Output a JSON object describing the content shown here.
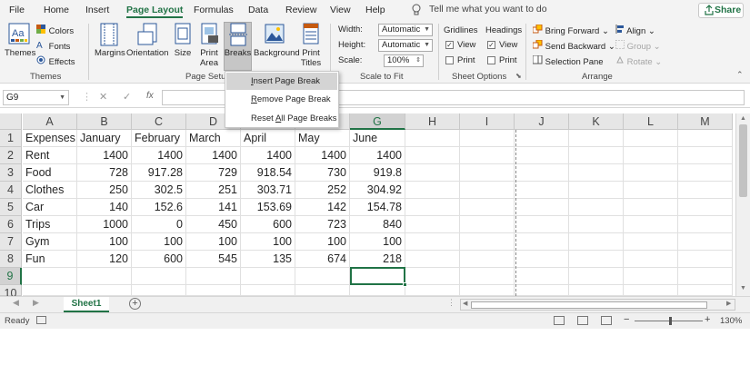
{
  "menu": {
    "tabs": [
      {
        "label": "File"
      },
      {
        "label": "Home"
      },
      {
        "label": "Insert"
      },
      {
        "label": "Page Layout",
        "active": true
      },
      {
        "label": "Formulas"
      },
      {
        "label": "Data"
      },
      {
        "label": "Review"
      },
      {
        "label": "View"
      },
      {
        "label": "Help"
      }
    ],
    "tell_me": "Tell me what you want to do",
    "share": "Share"
  },
  "ribbon": {
    "themes": {
      "big": "Themes",
      "colors": "Colors",
      "fonts": "Fonts",
      "effects": "Effects",
      "group": "Themes"
    },
    "page_setup": {
      "margins": "Margins",
      "orientation": "Orientation",
      "size": "Size",
      "print_area_1": "Print",
      "print_area_2": "Area",
      "breaks": "Breaks",
      "background": "Background",
      "print_titles_1": "Print",
      "print_titles_2": "Titles",
      "group": "Page Setup"
    },
    "scale_to_fit": {
      "width_label": "Width:",
      "width_value": "Automatic",
      "height_label": "Height:",
      "height_value": "Automatic",
      "scale_label": "Scale:",
      "scale_value": "100%",
      "group": "Scale to Fit"
    },
    "sheet_options": {
      "gridlines": "Gridlines",
      "headings": "Headings",
      "view": "View",
      "print": "Print",
      "gridlines_view": true,
      "gridlines_print": false,
      "headings_view": true,
      "headings_print": false,
      "group": "Sheet Options"
    },
    "arrange": {
      "bring_forward": "Bring Forward",
      "send_backward": "Send Backward",
      "selection_pane": "Selection Pane",
      "align": "Align",
      "group_btn": "Group",
      "rotate": "Rotate",
      "group": "Arrange"
    }
  },
  "breaks_menu": {
    "items": [
      "Insert Page Break",
      "Remove Page Break",
      "Reset All Page Breaks"
    ],
    "highlighted": 0
  },
  "formula_bar": {
    "name_box": "G9",
    "fx": "fx",
    "cancel": "✕",
    "enter": "✓",
    "content": ""
  },
  "grid": {
    "columns": [
      "A",
      "B",
      "C",
      "D",
      "E",
      "F",
      "G",
      "H",
      "I",
      "J",
      "K",
      "L",
      "M"
    ],
    "selected_column": "G",
    "rows": [
      "1",
      "2",
      "3",
      "4",
      "5",
      "6",
      "7",
      "8",
      "9",
      "10"
    ],
    "selected_row": "9",
    "cells": [
      [
        "Expenses",
        "January",
        "February",
        "March",
        "April",
        "May",
        "June"
      ],
      [
        "Rent",
        "1400",
        "1400",
        "1400",
        "1400",
        "1400",
        "1400"
      ],
      [
        "Food",
        "728",
        "917.28",
        "729",
        "918.54",
        "730",
        "919.8"
      ],
      [
        "Clothes",
        "250",
        "302.5",
        "251",
        "303.71",
        "252",
        "304.92"
      ],
      [
        "Car",
        "140",
        "152.6",
        "141",
        "153.69",
        "142",
        "154.78"
      ],
      [
        "Trips",
        "1000",
        "0",
        "450",
        "600",
        "723",
        "840"
      ],
      [
        "Gym",
        "100",
        "100",
        "100",
        "100",
        "100",
        "100"
      ],
      [
        "Fun",
        "120",
        "600",
        "545",
        "135",
        "674",
        "218"
      ]
    ]
  },
  "sheets": {
    "tabs": [
      "Sheet1"
    ],
    "active": "Sheet1"
  },
  "status": {
    "ready": "Ready",
    "zoom": "130%",
    "zoom_minus": "−",
    "zoom_plus": "+"
  },
  "colors": {
    "accent": "#217346",
    "ribbon_bg": "#f3f3f3",
    "header_bg": "#e6e6e6"
  }
}
